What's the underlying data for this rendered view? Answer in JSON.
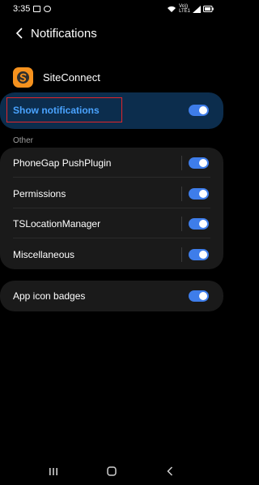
{
  "status_bar": {
    "time": "3:35",
    "network_label_top": "Vo))",
    "network_label_bottom": "LTE1"
  },
  "header": {
    "title": "Notifications",
    "back_icon": "chevron-left-icon"
  },
  "app": {
    "name": "SiteConnect",
    "icon": "siteconnect-app-icon",
    "icon_color": "#f6921e"
  },
  "show_notifications": {
    "label": "Show notifications",
    "enabled": true
  },
  "section": {
    "title": "Other"
  },
  "channels": [
    {
      "label": "PhoneGap PushPlugin",
      "enabled": true
    },
    {
      "label": "Permissions",
      "enabled": true
    },
    {
      "label": "TSLocationManager",
      "enabled": true
    },
    {
      "label": "Miscellaneous",
      "enabled": true
    }
  ],
  "app_icon_badges": {
    "label": "App icon badges",
    "enabled": true
  },
  "colors": {
    "accent": "#3e7dea",
    "highlight_text": "#4aa3ff",
    "highlight_box": "#e0262b",
    "card_bg": "#1a1a1a",
    "show_card_bg": "#0c2d4d"
  },
  "nav_bar": {
    "recents_icon": "recents-icon",
    "home_icon": "home-icon",
    "back_icon": "back-icon"
  }
}
